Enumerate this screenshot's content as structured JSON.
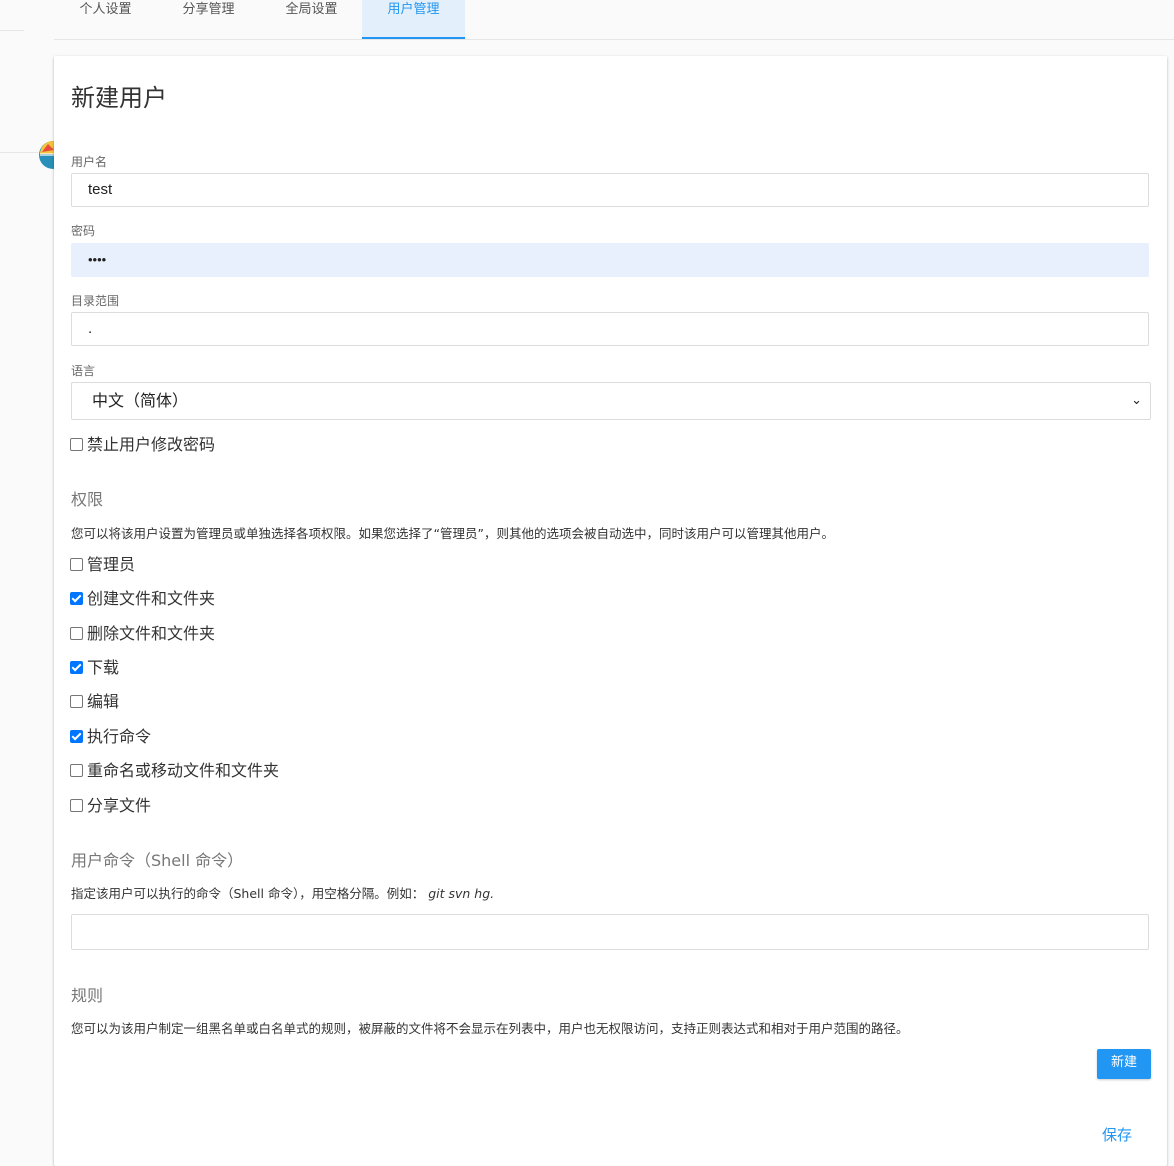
{
  "tabs": [
    {
      "label": "个人设置"
    },
    {
      "label": "分享管理"
    },
    {
      "label": "全局设置"
    },
    {
      "label": "用户管理"
    }
  ],
  "active_tab": "用户管理",
  "page": {
    "title": "新建用户"
  },
  "form": {
    "username_label": "用户名",
    "username_value": "test",
    "password_label": "密码",
    "password_value": "••••",
    "scope_label": "目录范围",
    "scope_value": ".",
    "language_label": "语言",
    "language_value": "中文（简体）",
    "lock_password_label": "禁止用户修改密码",
    "lock_password_checked": false
  },
  "permissions": {
    "title": "权限",
    "help": "您可以将该用户设置为管理员或单独选择各项权限。如果您选择了“管理员”，则其他的选项会被自动选中，同时该用户可以管理其他用户。",
    "items": [
      {
        "label": "管理员",
        "checked": false
      },
      {
        "label": "创建文件和文件夹",
        "checked": true
      },
      {
        "label": "删除文件和文件夹",
        "checked": false
      },
      {
        "label": "下载",
        "checked": true
      },
      {
        "label": "编辑",
        "checked": false
      },
      {
        "label": "执行命令",
        "checked": true
      },
      {
        "label": "重命名或移动文件和文件夹",
        "checked": false
      },
      {
        "label": "分享文件",
        "checked": false
      }
    ]
  },
  "commands": {
    "title": "用户命令（Shell 命令）",
    "help_prefix": "指定该用户可以执行的命令（Shell 命令），用空格分隔。例如：",
    "help_example": "git svn hg.",
    "value": ""
  },
  "rules": {
    "title": "规则",
    "help": "您可以为该用户制定一组黑名单或白名单式的规则，被屏蔽的文件将不会显示在列表中，用户也无权限访问，支持正则表达式和相对于用户范围的路径。",
    "new_button": "新建"
  },
  "save_button": "保存",
  "colors": {
    "accent": "#2196f3",
    "checkbox": "#0075ff",
    "autofill": "#e8f0fe"
  }
}
